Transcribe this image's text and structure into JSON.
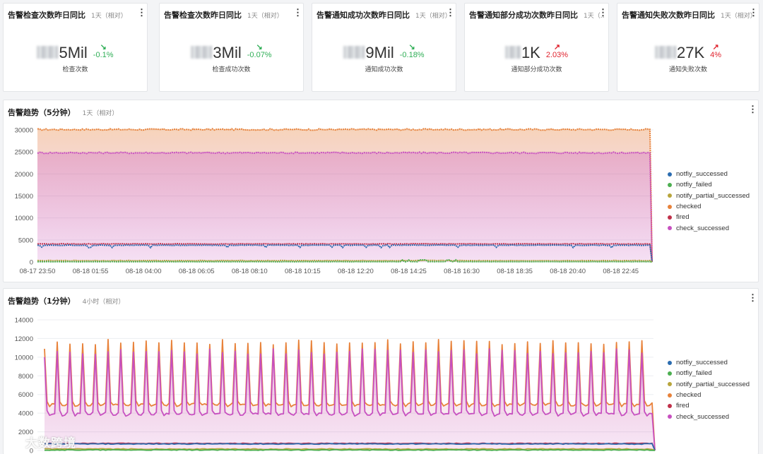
{
  "stat_cards": [
    {
      "title": "告警检查次数昨日同比",
      "range": "1天（相对）",
      "value_tail": "5Mil",
      "change": "-0.1%",
      "direction": "down",
      "label": "检查次数"
    },
    {
      "title": "告警检查次数昨日同比",
      "range": "1天（相对）",
      "value_tail": "3Mil",
      "change": "-0.07%",
      "direction": "down",
      "label": "检查成功次数"
    },
    {
      "title": "告警通知成功次数昨日同比",
      "range": "1天（相对）",
      "value_tail": "9Mil",
      "change": "-0.18%",
      "direction": "down",
      "label": "通知成功次数"
    },
    {
      "title": "告警通知部分成功次数昨日同比",
      "range": "1天（...",
      "value_tail": "1K",
      "change": "2.03%",
      "direction": "up",
      "label": "通知部分成功次数"
    },
    {
      "title": "告警通知失败次数昨日同比",
      "range": "1天（相对）",
      "value_tail": "27K",
      "change": "4%",
      "direction": "up",
      "label": "通知失败次数"
    }
  ],
  "panels": {
    "p5": {
      "title": "告警趋势（5分钟）",
      "range": "1天（相对）"
    },
    "p1": {
      "title": "告警趋势（1分钟）",
      "range": "4小时（相对）"
    }
  },
  "legend": [
    {
      "name": "notfiy_successed",
      "color": "#2b6cb0"
    },
    {
      "name": "notfiy_failed",
      "color": "#4caf50"
    },
    {
      "name": "notify_partial_successed",
      "color": "#b8a53c"
    },
    {
      "name": "checked",
      "color": "#e8823a"
    },
    {
      "name": "fired",
      "color": "#c0304a"
    },
    {
      "name": "check_successed",
      "color": "#c750c0"
    }
  ],
  "watermark": "大数跨境",
  "colors": {
    "accent_down": "#2fae56",
    "accent_up": "#e0222d"
  },
  "chart_data": [
    {
      "type": "area",
      "ylim": [
        0,
        30000
      ],
      "y_ticks": [
        0,
        5000,
        10000,
        15000,
        20000,
        25000,
        30000
      ],
      "y_tick_labels": [
        "0",
        "5000",
        "10000",
        "15000",
        "20000",
        "25000",
        "30000"
      ],
      "x_tick_labels": [
        "08-17 23:50",
        "08-18 01:55",
        "08-18 04:00",
        "08-18 06:05",
        "08-18 08:10",
        "08-18 10:15",
        "08-18 12:20",
        "08-18 14:25",
        "08-18 16:30",
        "08-18 18:35",
        "08-18 20:40",
        "08-18 22:45"
      ],
      "grid": true,
      "legend_position": "right",
      "series": [
        {
          "name": "notfiy_successed",
          "level": 3800,
          "drop_to": 0
        },
        {
          "name": "notfiy_failed",
          "level": 60,
          "drop_to": 0
        },
        {
          "name": "notify_partial_successed",
          "level": 300,
          "drop_to": 0
        },
        {
          "name": "checked",
          "level": 30100,
          "drop_to": 0
        },
        {
          "name": "fired",
          "level": 4100,
          "drop_to": 0
        },
        {
          "name": "check_successed",
          "level": 24800,
          "drop_to": 0
        }
      ]
    },
    {
      "type": "area",
      "ylim": [
        0,
        14000
      ],
      "y_ticks": [
        0,
        2000,
        4000,
        6000,
        8000,
        10000,
        12000,
        14000
      ],
      "y_tick_labels": [
        "0",
        "2000",
        "4000",
        "6000",
        "8000",
        "10000",
        "12000",
        "14000"
      ],
      "grid": true,
      "legend_position": "right",
      "spike_count": 48,
      "series": [
        {
          "name": "notfiy_successed",
          "base": 700,
          "peak": 700
        },
        {
          "name": "notfiy_failed",
          "base": 50,
          "peak": 50
        },
        {
          "name": "notify_partial_successed",
          "base": 150,
          "peak": 150
        },
        {
          "name": "checked",
          "base": 4600,
          "peak": 11600
        },
        {
          "name": "fired",
          "base": 750,
          "peak": 750
        },
        {
          "name": "check_successed",
          "base": 3600,
          "peak": 10600
        }
      ]
    }
  ]
}
